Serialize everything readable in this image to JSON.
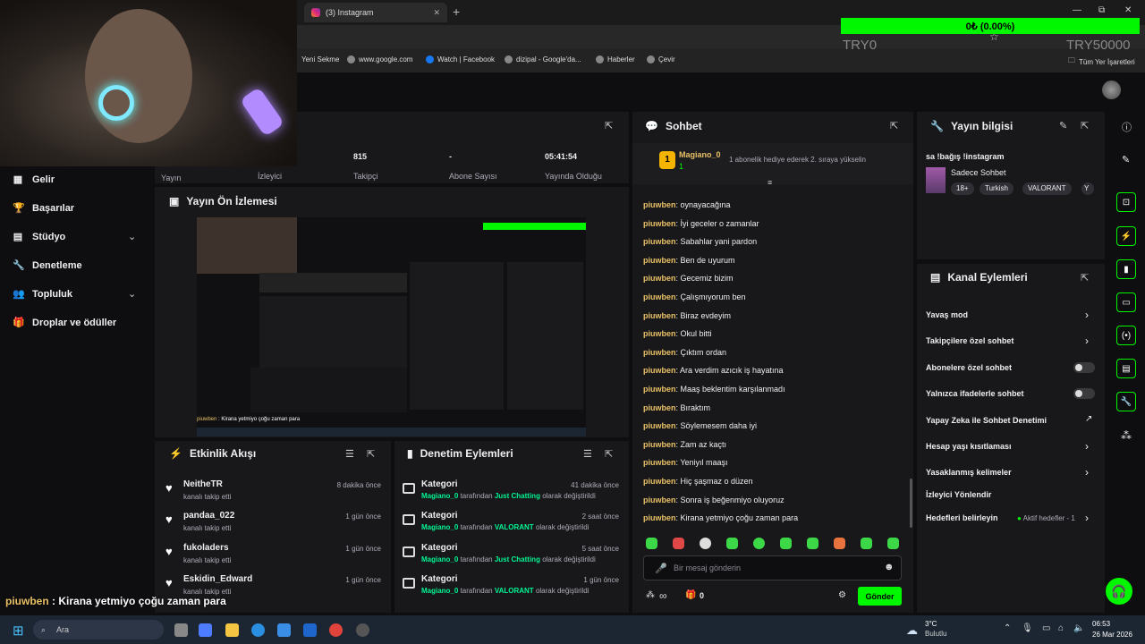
{
  "browser": {
    "tab_title": "(3) Instagram",
    "tab_close": "✕",
    "new_tab": "+",
    "window_controls": [
      "—",
      "⧉",
      "✕"
    ],
    "bookmarks": [
      "Yeni Sekme",
      "www.google.com",
      "Watch | Facebook",
      "dizipal - Google'da...",
      "Haberler",
      "Çevir"
    ],
    "all_bookmarks": "Tüm Yer İşaretleri"
  },
  "overlay": {
    "follower_goal": "0₺ (0.00%)",
    "goal_left": "TRY0",
    "goal_right": "TRY50000",
    "chat_user": "piuwben",
    "chat_message": "Kirana yetmiyo çoğu zaman para"
  },
  "sidebar": {
    "items": [
      {
        "label": "Gelir",
        "icon": "bar-chart-icon",
        "glyph": "▦"
      },
      {
        "label": "Başarılar",
        "icon": "trophy-icon",
        "glyph": "🏆"
      },
      {
        "label": "Stüdyo",
        "icon": "studio-icon",
        "glyph": "▤",
        "chevron": true
      },
      {
        "label": "Denetleme",
        "icon": "wrench-icon",
        "glyph": "🔧"
      },
      {
        "label": "Topluluk",
        "icon": "people-icon",
        "glyph": "👥",
        "chevron": true
      },
      {
        "label": "Droplar ve ödüller",
        "icon": "gift-icon",
        "glyph": "🎁"
      }
    ]
  },
  "stats": {
    "viewers_label": "İzleyici",
    "broadcast_label": "Yayın",
    "followers_value": "815",
    "followers_label": "Takipçi",
    "subs_value": "-",
    "subs_label": "Abone Sayısı",
    "uptime_value": "05:41:54",
    "uptime_label": "Yayında Olduğu"
  },
  "preview": {
    "title": "Yayın Ön İzlemesi"
  },
  "activity": {
    "title": "Etkinlik Akışı",
    "items": [
      {
        "name": "NeitheTR",
        "sub": "kanalı takip etti",
        "time": "8 dakika önce"
      },
      {
        "name": "pandaa_022",
        "sub": "kanalı takip etti",
        "time": "1 gün önce"
      },
      {
        "name": "fukoladers",
        "sub": "kanalı takip etti",
        "time": "1 gün önce"
      },
      {
        "name": "Eskidin_Edward",
        "sub": "kanalı takip etti",
        "time": "1 gün önce"
      }
    ]
  },
  "moderation": {
    "title": "Denetim Eylemleri",
    "items": [
      {
        "kind": "Kategori",
        "user": "Magiano_0",
        "mid": "tarafından",
        "cat": "Just Chatting",
        "end": "olarak değiştirildi",
        "time": "41 dakika önce"
      },
      {
        "kind": "Kategori",
        "user": "Magiano_0",
        "mid": "tarafından",
        "cat": "VALORANT",
        "end": "olarak değiştirildi",
        "time": "2 saat önce"
      },
      {
        "kind": "Kategori",
        "user": "Magiano_0",
        "mid": "tarafından",
        "cat": "Just Chatting",
        "end": "olarak değiştirildi",
        "time": "5 saat önce"
      },
      {
        "kind": "Kategori",
        "user": "Magiano_0",
        "mid": "tarafından",
        "cat": "VALORANT",
        "end": "olarak değiştirildi",
        "time": "1 gün önce"
      }
    ]
  },
  "chat": {
    "title": "Sohbet",
    "pinned_user": "Magiano_0",
    "pinned_rank": "1",
    "pinned_count": "1",
    "pinned_text": "1 abonelik hediye ederek 2. sıraya yükselin",
    "user": "piuwben",
    "messages": [
      "oynayacağına",
      "İyi geceler o zamanlar",
      "Sabahlar yani pardon",
      "Ben de uyurum",
      "Gecemiz bizim",
      "Çalışmıyorum ben",
      "Biraz evdeyim",
      "Okul bitti",
      "Çıktım ordan",
      "Ara verdim azıcık iş hayatına",
      "Maaş beklentim karşılanmadı",
      "Bıraktım",
      "Söylemesem daha iyi",
      "Zam az kaçtı",
      "Yeniyıl maaşı",
      "Hiç şaşmaz o düzen",
      "Sonra iş beğenmiyo oluyoruz",
      "Kirana yetmiyo çoğu zaman para"
    ],
    "input_placeholder": "Bir mesaj gönderin",
    "points_glyph": "∞",
    "gift_count": "0",
    "send_label": "Gönder"
  },
  "stream_info": {
    "title": "Yayın bilgisi",
    "stream_title": "sa !bağış !instagram",
    "category": "Sadece Sohbet",
    "tags": [
      "18+",
      "Turkish",
      "VALORANT",
      "Y"
    ]
  },
  "channel_actions": {
    "title": "Kanal Eylemleri",
    "items": [
      {
        "label": "Yavaş mod",
        "control": "chevron"
      },
      {
        "label": "Takipçilere özel sohbet",
        "control": "chevron"
      },
      {
        "label": "Abonelere özel sohbet",
        "control": "toggle"
      },
      {
        "label": "Yalnızca ifadelerle sohbet",
        "control": "toggle"
      },
      {
        "label": "Yapay Zeka ile Sohbet Denetimi",
        "control": "external"
      },
      {
        "label": "Hesap yaşı kısıtlaması",
        "control": "chevron"
      },
      {
        "label": "Yasaklanmış kelimeler",
        "control": "chevron"
      },
      {
        "label": "İzleyici Yönlendir",
        "control": "none"
      },
      {
        "label": "Hedefleri belirleyin",
        "control": "chevron",
        "extra": "Aktif hedefler - 1"
      }
    ]
  },
  "taskbar": {
    "search_placeholder": "Ara",
    "weather_temp": "3°C",
    "weather_desc": "Bulutlu",
    "time": "06:53",
    "date": "26 Mar 2026"
  },
  "colors": {
    "accent": "#00f700",
    "chat_user": "#e8c066",
    "mod_highlight": "#00f593"
  }
}
